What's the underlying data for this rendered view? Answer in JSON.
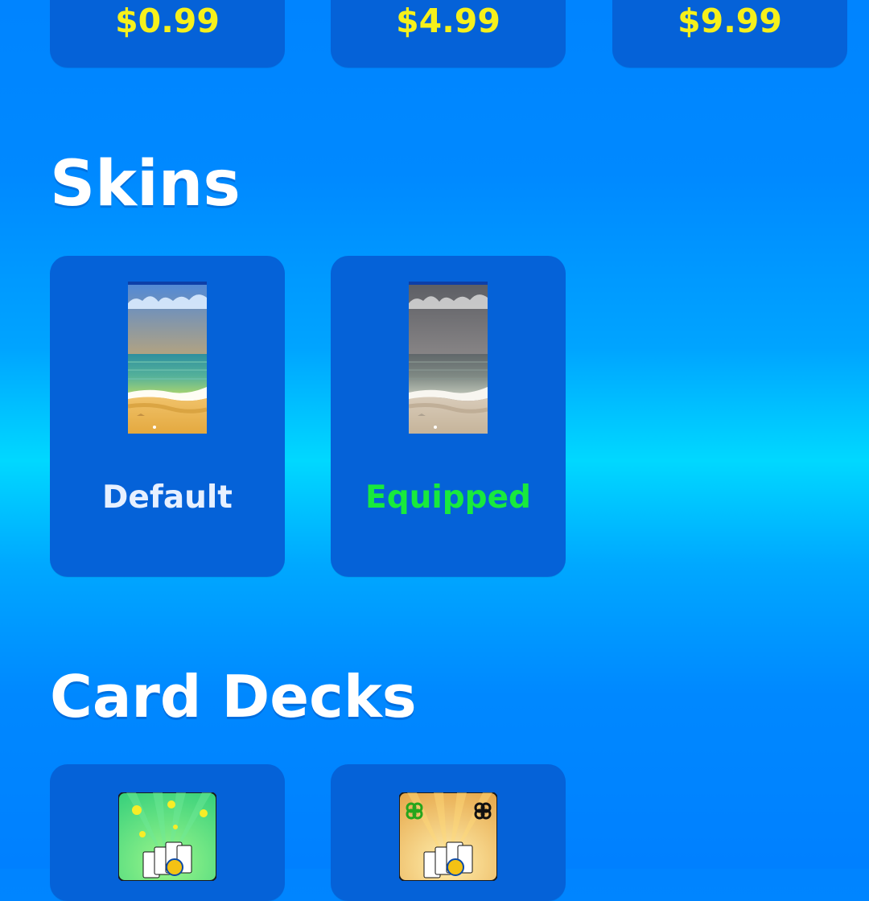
{
  "prices": [
    {
      "amount": "$0.99"
    },
    {
      "amount": "$4.99"
    },
    {
      "amount": "$9.99"
    }
  ],
  "sections": {
    "skins": {
      "title": "Skins",
      "items": [
        {
          "label": "Default",
          "state": "available"
        },
        {
          "label": "Equipped",
          "state": "equipped"
        }
      ]
    },
    "card_decks": {
      "title": "Card Decks",
      "items": [
        {
          "art": "green-starburst-deck-icon"
        },
        {
          "art": "gold-starburst-deck-icon"
        }
      ]
    }
  },
  "colors": {
    "card_background": "#0562d8",
    "price_text": "#f6f01b",
    "title_text": "#ffffff",
    "default_label": "#e7f0ff",
    "equipped_label": "#18ea3d"
  }
}
